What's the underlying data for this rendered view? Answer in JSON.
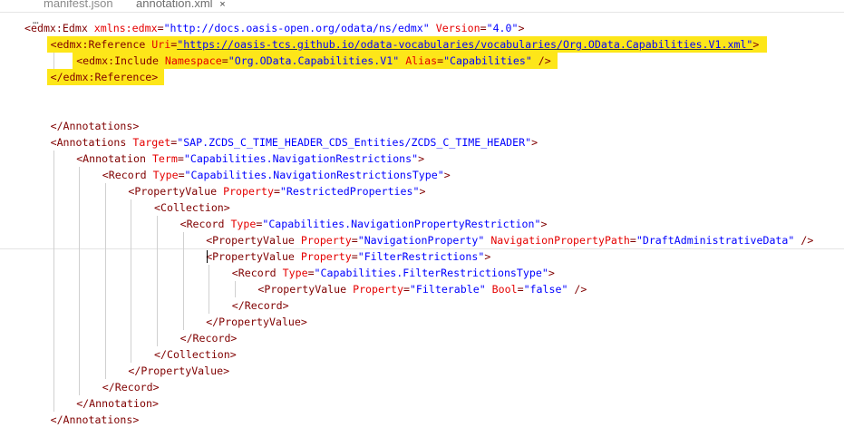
{
  "tabs": [
    {
      "label": "manifest.json",
      "active": false
    },
    {
      "label": "annotation.xml",
      "active": true,
      "close": "×"
    }
  ],
  "fold_marker": "…",
  "lines": [
    {
      "indent": 0,
      "tokens": [
        [
          "t",
          "<edmx:Edmx "
        ],
        [
          "a",
          "xmlns:edmx"
        ],
        [
          "p",
          "="
        ],
        [
          "v",
          "\"http://docs.oasis-open.org/odata/ns/edmx\""
        ],
        [
          "p",
          " "
        ],
        [
          "a",
          "Version"
        ],
        [
          "p",
          "="
        ],
        [
          "v",
          "\"4.0\""
        ],
        [
          "t",
          ">"
        ]
      ]
    },
    {
      "indent": 1,
      "tokens": [
        [
          "t",
          "<edmx:Reference "
        ],
        [
          "a",
          "Uri"
        ],
        [
          "p",
          "="
        ],
        [
          "v",
          "\"https://oasis-tcs.github.io/odata-vocabularies/vocabularies/Org.OData.Capabilities.V1.xml\""
        ],
        [
          "t",
          ">"
        ]
      ],
      "highlight": true
    },
    {
      "indent": 2,
      "tokens": [
        [
          "t",
          "<edmx:Include "
        ],
        [
          "a",
          "Namespace"
        ],
        [
          "p",
          "="
        ],
        [
          "v",
          "\"Org.OData.Capabilities.V1\""
        ],
        [
          "p",
          " "
        ],
        [
          "a",
          "Alias"
        ],
        [
          "p",
          "="
        ],
        [
          "v",
          "\"Capabilities\""
        ],
        [
          "t",
          " />"
        ]
      ],
      "highlight": true
    },
    {
      "indent": 1,
      "tokens": [
        [
          "t",
          "</edmx:Reference>"
        ]
      ],
      "highlight": true
    },
    {
      "indent": 0,
      "tokens": []
    },
    {
      "indent": 0,
      "tokens": []
    },
    {
      "indent": 1,
      "tokens": [
        [
          "t",
          "</Annotations>"
        ]
      ]
    },
    {
      "indent": 1,
      "tokens": [
        [
          "t",
          "<Annotations "
        ],
        [
          "a",
          "Target"
        ],
        [
          "p",
          "="
        ],
        [
          "v",
          "\"SAP.ZCDS_C_TIME_HEADER_CDS_Entities/ZCDS_C_TIME_HEADER\""
        ],
        [
          "t",
          ">"
        ]
      ]
    },
    {
      "indent": 2,
      "tokens": [
        [
          "t",
          "<Annotation "
        ],
        [
          "a",
          "Term"
        ],
        [
          "p",
          "="
        ],
        [
          "v",
          "\"Capabilities.NavigationRestrictions\""
        ],
        [
          "t",
          ">"
        ]
      ]
    },
    {
      "indent": 3,
      "tokens": [
        [
          "t",
          "<Record "
        ],
        [
          "a",
          "Type"
        ],
        [
          "p",
          "="
        ],
        [
          "v",
          "\"Capabilities.NavigationRestrictionsType\""
        ],
        [
          "t",
          ">"
        ]
      ]
    },
    {
      "indent": 4,
      "tokens": [
        [
          "t",
          "<PropertyValue "
        ],
        [
          "a",
          "Property"
        ],
        [
          "p",
          "="
        ],
        [
          "v",
          "\"RestrictedProperties\""
        ],
        [
          "t",
          ">"
        ]
      ]
    },
    {
      "indent": 5,
      "tokens": [
        [
          "t",
          "<Collection>"
        ]
      ]
    },
    {
      "indent": 6,
      "tokens": [
        [
          "t",
          "<Record "
        ],
        [
          "a",
          "Type"
        ],
        [
          "p",
          "="
        ],
        [
          "v",
          "\"Capabilities.NavigationPropertyRestriction\""
        ],
        [
          "t",
          ">"
        ]
      ]
    },
    {
      "indent": 7,
      "tokens": [
        [
          "t",
          "<PropertyValue "
        ],
        [
          "a",
          "Property"
        ],
        [
          "p",
          "="
        ],
        [
          "v",
          "\"NavigationProperty\""
        ],
        [
          "p",
          " "
        ],
        [
          "a",
          "NavigationPropertyPath"
        ],
        [
          "p",
          "="
        ],
        [
          "v",
          "\"DraftAdministrativeData\""
        ],
        [
          "t",
          " />"
        ]
      ]
    },
    {
      "indent": 7,
      "tokens": [
        [
          "t",
          "<PropertyValue "
        ],
        [
          "a",
          "Property"
        ],
        [
          "p",
          "="
        ],
        [
          "v",
          "\"FilterRestrictions\""
        ],
        [
          "t",
          ">"
        ]
      ],
      "current": true
    },
    {
      "indent": 8,
      "tokens": [
        [
          "t",
          "<Record "
        ],
        [
          "a",
          "Type"
        ],
        [
          "p",
          "="
        ],
        [
          "v",
          "\"Capabilities.FilterRestrictionsType\""
        ],
        [
          "t",
          ">"
        ]
      ]
    },
    {
      "indent": 9,
      "tokens": [
        [
          "t",
          "<PropertyValue "
        ],
        [
          "a",
          "Property"
        ],
        [
          "p",
          "="
        ],
        [
          "v",
          "\"Filterable\""
        ],
        [
          "p",
          " "
        ],
        [
          "a",
          "Bool"
        ],
        [
          "p",
          "="
        ],
        [
          "v",
          "\"false\""
        ],
        [
          "t",
          " />"
        ]
      ]
    },
    {
      "indent": 8,
      "tokens": [
        [
          "t",
          "</Record>"
        ]
      ]
    },
    {
      "indent": 7,
      "tokens": [
        [
          "t",
          "</PropertyValue>"
        ]
      ]
    },
    {
      "indent": 6,
      "tokens": [
        [
          "t",
          "</Record>"
        ]
      ]
    },
    {
      "indent": 5,
      "tokens": [
        [
          "t",
          "</Collection>"
        ]
      ]
    },
    {
      "indent": 4,
      "tokens": [
        [
          "t",
          "</PropertyValue>"
        ]
      ]
    },
    {
      "indent": 3,
      "tokens": [
        [
          "t",
          "</Record>"
        ]
      ]
    },
    {
      "indent": 2,
      "tokens": [
        [
          "t",
          "</Annotation>"
        ]
      ]
    },
    {
      "indent": 1,
      "tokens": [
        [
          "t",
          "</Annotations>"
        ]
      ]
    }
  ],
  "colors": {
    "tag": "#800000",
    "attribute": "#e50000",
    "value": "#0000ff",
    "highlight": "#fde619"
  }
}
